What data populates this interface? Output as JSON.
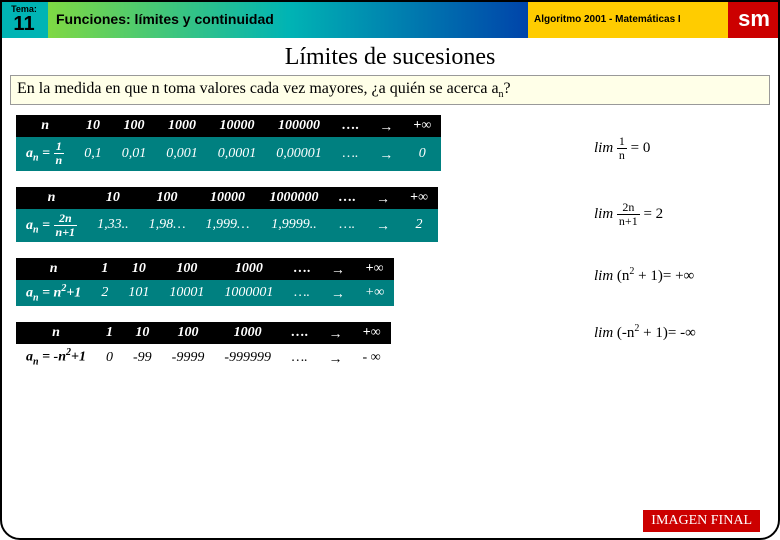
{
  "header": {
    "tema_label": "Tema:",
    "tema_num": "11",
    "left": "Funciones: límites y continuidad",
    "right": "Algoritmo 2001 - Matemáticas I",
    "logo": "sm"
  },
  "title": "Límites de sucesiones",
  "question_pre": "En la medida en que n toma valores cada vez mayores, ¿a quién se acerca a",
  "question_sub": "n",
  "question_post": "?",
  "t1": {
    "h": [
      "n",
      "10",
      "100",
      "1000",
      "10000",
      "100000",
      "….",
      "→",
      "+∞"
    ],
    "lbl_html": "a<sub>n</sub> = <span class='frac'><span class='n'>1</span><span class='d'>n</span></span>",
    "d": [
      "0,1",
      "0,01",
      "0,001",
      "0,0001",
      "0,00001",
      "….",
      "→",
      "0"
    ]
  },
  "t2": {
    "h": [
      "n",
      "10",
      "100",
      "10000",
      "1000000",
      "….",
      "→",
      "+∞"
    ],
    "lbl_html": "a<sub>n</sub> = <span class='frac'><span class='n'>2n</span><span class='d'>n+1</span></span>",
    "d": [
      "1,33..",
      "1,98…",
      "1,999…",
      "1,9999..",
      "….",
      "→",
      "2"
    ]
  },
  "t3": {
    "h": [
      "n",
      "1",
      "10",
      "100",
      "1000",
      "….",
      "→",
      "+∞"
    ],
    "lbl_html": "a<sub>n</sub> = n<sup>2</sup>+1",
    "d": [
      "2",
      "101",
      "10001",
      "1000001",
      "….",
      "→",
      "+∞"
    ]
  },
  "t4": {
    "h": [
      "n",
      "1",
      "10",
      "100",
      "1000",
      "….",
      "→",
      "+∞"
    ],
    "lbl_html": "a<sub>n</sub> = -n<sup>2</sup>+1",
    "d": [
      "0",
      "-99",
      "-9999",
      "-999999",
      "….",
      "→",
      "- ∞"
    ]
  },
  "lim1_html": "<i>lim</i> <span class='frac'><span class='n'>1</span><span class='d'>n</span></span> = 0",
  "lim2_html": "<i>lim</i> <span class='frac'><span class='n'>2n</span><span class='d'>n+1</span></span> = 2",
  "lim3_html": "<i>lim</i> (n<sup>2</sup> + 1)= +∞",
  "lim4_html": "<i>lim</i> (-n<sup>2</sup> + 1)= -∞",
  "footer": "IMAGEN FINAL"
}
